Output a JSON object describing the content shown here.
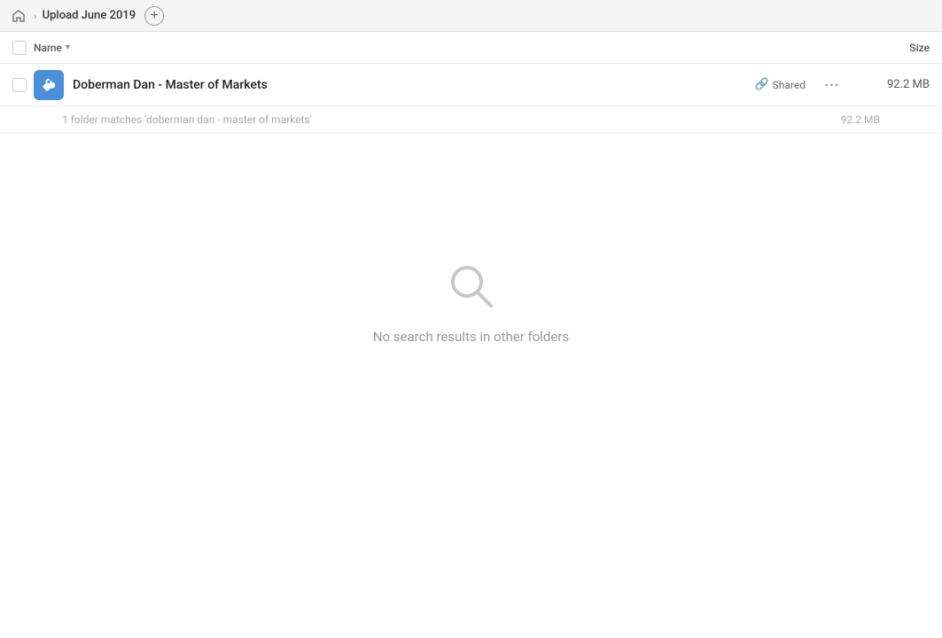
{
  "header": {
    "home_icon": "house",
    "breadcrumb_title": "Upload June 2019",
    "add_button_label": "+"
  },
  "columns": {
    "name_label": "Name",
    "sort_icon": "▾",
    "size_label": "Size"
  },
  "file_row": {
    "icon_color": "#4a90d9",
    "file_name": "Doberman Dan - Master of Markets",
    "shared_label": "Shared",
    "more_label": "···",
    "file_size": "92.2 MB"
  },
  "match_info": {
    "text": "1 folder matches 'doberman dan - master of markets'",
    "size": "92.2 MB"
  },
  "empty_state": {
    "message": "No search results in other folders"
  }
}
